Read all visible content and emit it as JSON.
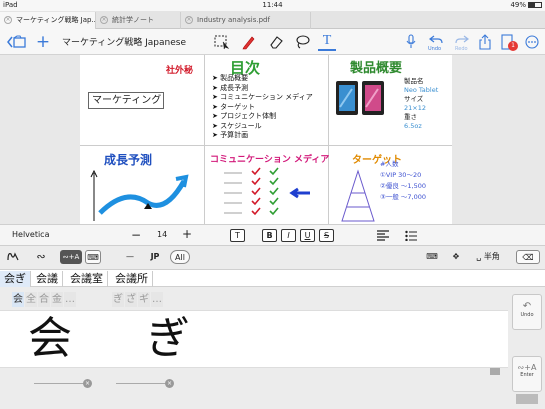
{
  "status_bar": {
    "device": "iPad",
    "time": "11:44",
    "battery": "49%"
  },
  "tabs": [
    {
      "label": "マーケティング戦略 Jap..."
    },
    {
      "label": "統計学ノート"
    },
    {
      "label": "Industry analysis.pdf"
    }
  ],
  "toolbar": {
    "document_title": "マーケティング戦略 Japanese",
    "undo_label": "Undo",
    "redo_label": "Redo",
    "notification_count": "1"
  },
  "canvas": {
    "text_box_value": "マーケティング",
    "notes": {
      "confidential": "社外秘",
      "toc_title": "目次",
      "toc_items": [
        "製品概要",
        "成長予測",
        "コミュニケーション メディア",
        "ターゲット",
        "プロジェクト体制",
        "スケジュール",
        "予算計画"
      ],
      "product_title": "製品概要",
      "product_lines": [
        "製品名",
        "Neo Tablet",
        "サイズ",
        "21×12",
        "重さ",
        "6.5oz"
      ],
      "growth_title": "成長予測",
      "media_title": "コミュニケーション メディア",
      "target_title": "ターゲット",
      "target_lines": [
        "#人数",
        "①VIP 30〜20",
        "②優良 〜1,500",
        "③一般 〜7,000"
      ]
    }
  },
  "format_bar": {
    "font": "Helvetica",
    "font_size": "14",
    "minus": "−",
    "plus": "+",
    "text_btn": "T",
    "bold": "B",
    "italic": "I",
    "underline": "U",
    "strike": "S"
  },
  "keyboard": {
    "lang": "JP",
    "all": "All",
    "half_width": "半角",
    "candidates": [
      "会ぎ",
      "会議",
      "会議室",
      "会議所"
    ],
    "char_group_1": [
      "会",
      "全",
      "合",
      "金",
      "…"
    ],
    "char_group_2": [
      "ぎ",
      "ざ",
      "ギ",
      "…"
    ],
    "handwriting": "会 ぎ",
    "side_undo": "Undo",
    "side_enter": "Enter"
  }
}
